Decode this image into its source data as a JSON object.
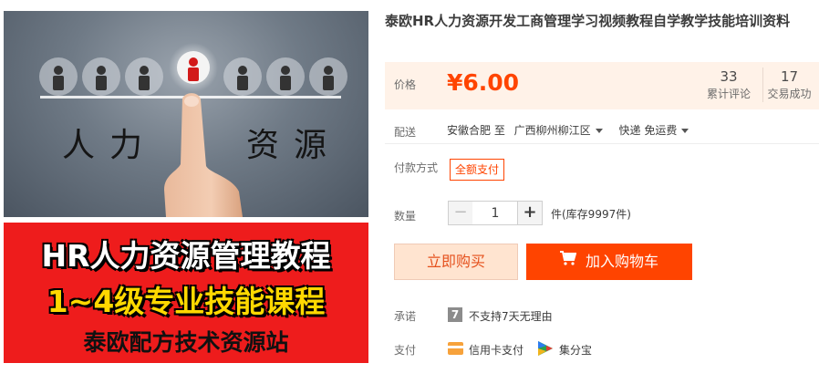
{
  "image": {
    "photo_left_text": "人力",
    "photo_right_text": "资源",
    "banner_line1": "HR人力资源管理教程",
    "banner_line2": "1~4级专业技能课程",
    "banner_line3": "泰欧配方技术资源站"
  },
  "product": {
    "title": "泰欧HR人力资源开发工商管理学习视频教程自学教学技能培训资料",
    "price_label": "价格",
    "price": "¥6.00",
    "reviews_count": "33",
    "reviews_label": "累计评论",
    "sales_count": "17",
    "sales_label": "交易成功"
  },
  "shipping": {
    "label": "配送",
    "from": "安徽合肥 至",
    "to": "广西柳州柳江区",
    "method": "快递 免运费"
  },
  "payment_method": {
    "label": "付款方式",
    "option": "全额支付"
  },
  "quantity": {
    "label": "数量",
    "minus": "−",
    "value": "1",
    "plus": "+",
    "stock": "件(库存9997件)"
  },
  "actions": {
    "buy_now": "立即购买",
    "add_to_cart": "加入购物车"
  },
  "promise": {
    "label": "承诺",
    "icon_text": "7",
    "text": "不支持7天无理由"
  },
  "pay": {
    "label": "支付",
    "credit_card": "信用卡支付",
    "jifenbao": "集分宝"
  },
  "colors": {
    "accent": "#ff4400",
    "price_bg": "#fff2e8",
    "banner_red": "#ee1c1c",
    "banner_yellow": "#ffd800"
  },
  "icons": [
    "person-icon",
    "cart-icon",
    "promise-7-icon",
    "credit-card-icon",
    "jifenbao-icon",
    "caret-down-icon"
  ]
}
